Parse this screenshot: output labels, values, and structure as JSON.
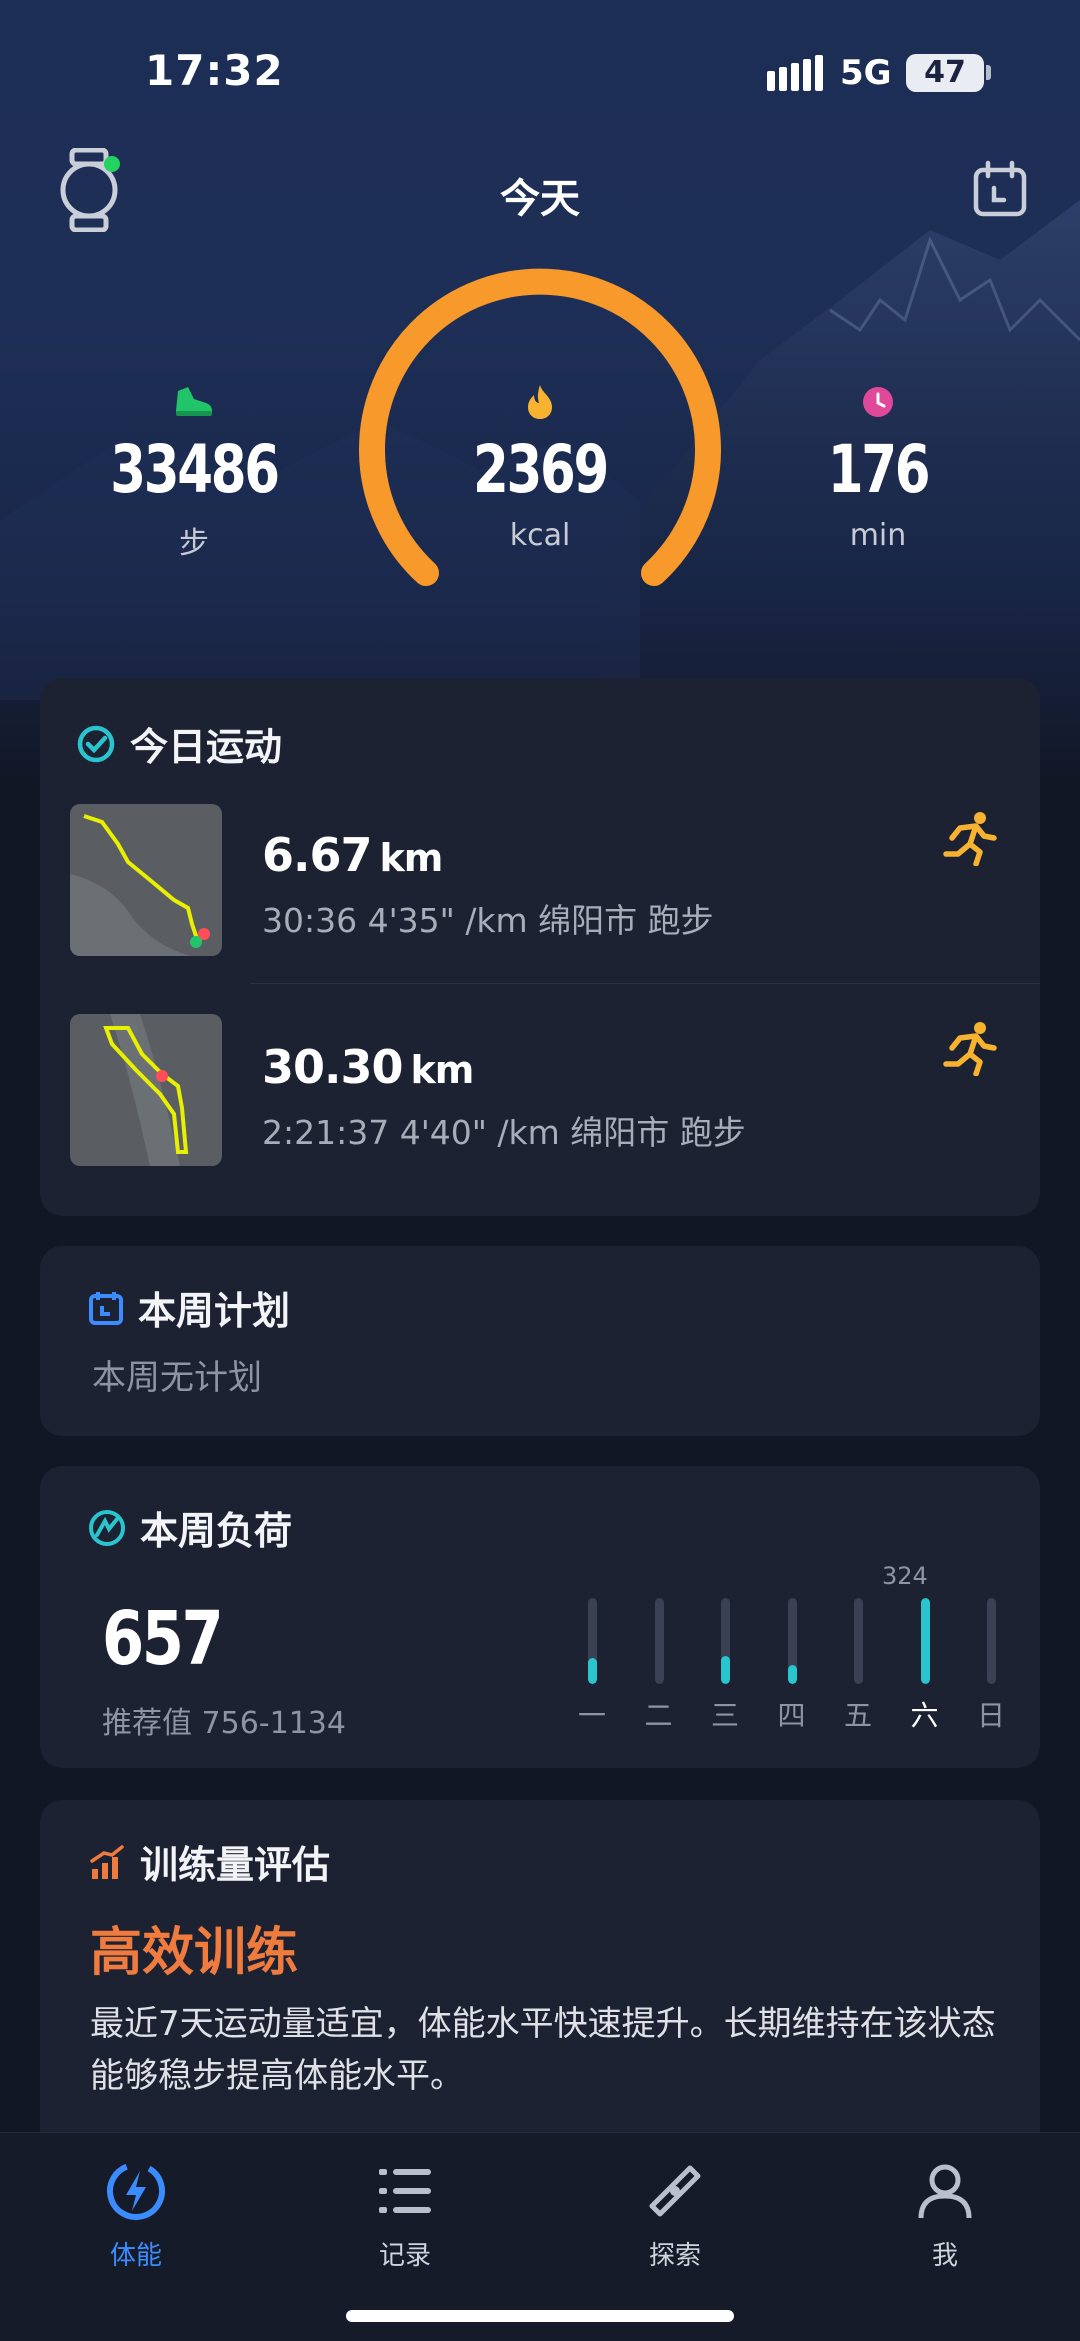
{
  "status_bar": {
    "time": "17:32",
    "network": "5G",
    "battery": "47"
  },
  "header": {
    "title": "今天"
  },
  "stats": {
    "steps": {
      "value": "33486",
      "unit": "步"
    },
    "calories": {
      "value": "2369",
      "unit": "kcal"
    },
    "minutes": {
      "value": "176",
      "unit": "min"
    },
    "ring_color": "#f7992b"
  },
  "today_activities": {
    "title": "今日运动",
    "items": [
      {
        "distance": "6.67",
        "unit": "km",
        "detail": "30:36  4'35\" /km 绵阳市 跑步"
      },
      {
        "distance": "30.30",
        "unit": "km",
        "detail": "2:21:37  4'40\" /km 绵阳市 跑步"
      }
    ]
  },
  "weekly_plan": {
    "title": "本周计划",
    "subtitle": "本周无计划"
  },
  "weekly_load": {
    "title": "本周负荷",
    "value": "657",
    "recommended": "推荐值 756-1134",
    "peak_label": "324",
    "days": [
      "一",
      "二",
      "三",
      "四",
      "五",
      "六",
      "日"
    ],
    "levels": [
      0.3,
      0,
      0.32,
      0.22,
      0,
      1.0,
      0
    ],
    "active_index": 5,
    "bar_color": "#2ac4cf"
  },
  "training_eval": {
    "title": "训练量评估",
    "level": "高效训练",
    "description": "最近7天运动量适宜，体能水平快速提升。长期维持在该状态能够稳步提高体能水平。"
  },
  "tabbar": {
    "items": [
      {
        "label": "体能",
        "icon": "lightning-icon"
      },
      {
        "label": "记录",
        "icon": "list-icon"
      },
      {
        "label": "探索",
        "icon": "compass-icon"
      },
      {
        "label": "我",
        "icon": "user-icon"
      }
    ],
    "active_color": "#3b8cff"
  }
}
